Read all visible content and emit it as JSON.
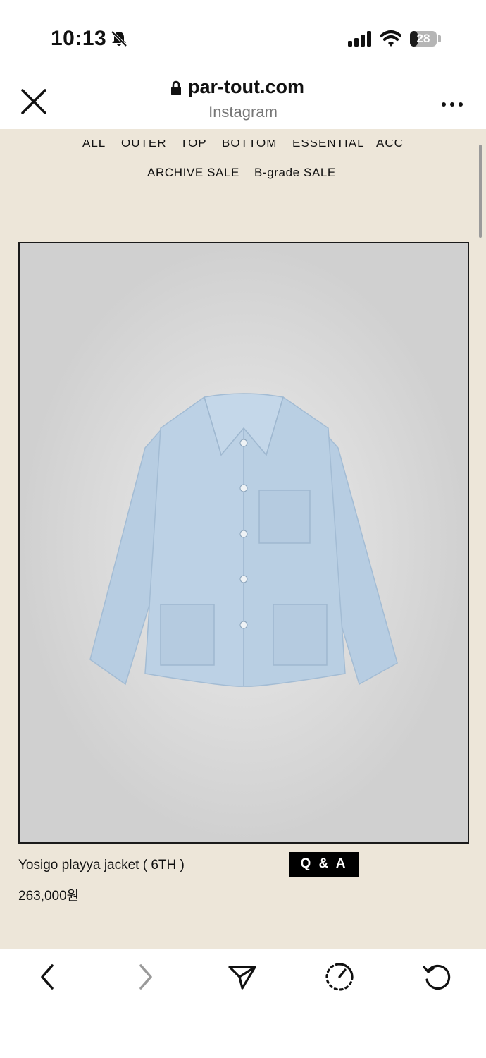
{
  "status": {
    "time": "10:13",
    "battery": "28",
    "battery_level": 0.28
  },
  "browser": {
    "url": "par-tout.com",
    "subtitle": "Instagram"
  },
  "nav": {
    "row1": [
      "ALL",
      "OUTER",
      "TOP",
      "BOTTOM",
      "ESSENTIAL",
      "ACC"
    ],
    "row2": [
      "ARCHIVE SALE",
      "B-grade SALE"
    ]
  },
  "product": {
    "name": "Yosigo playya jacket ( 6TH )",
    "price": "263,000원",
    "qa_label": "Q & A"
  },
  "icons": {
    "close": "close-icon",
    "lock": "lock-icon",
    "more": "more-icon",
    "back": "back-icon",
    "forward": "forward-icon",
    "send": "send-icon",
    "timer": "timer-icon",
    "reload": "reload-icon"
  },
  "colors": {
    "page_bg": "#ede6d9",
    "image_bg": "#d0d0d0",
    "jacket": "#b9cfe3"
  }
}
